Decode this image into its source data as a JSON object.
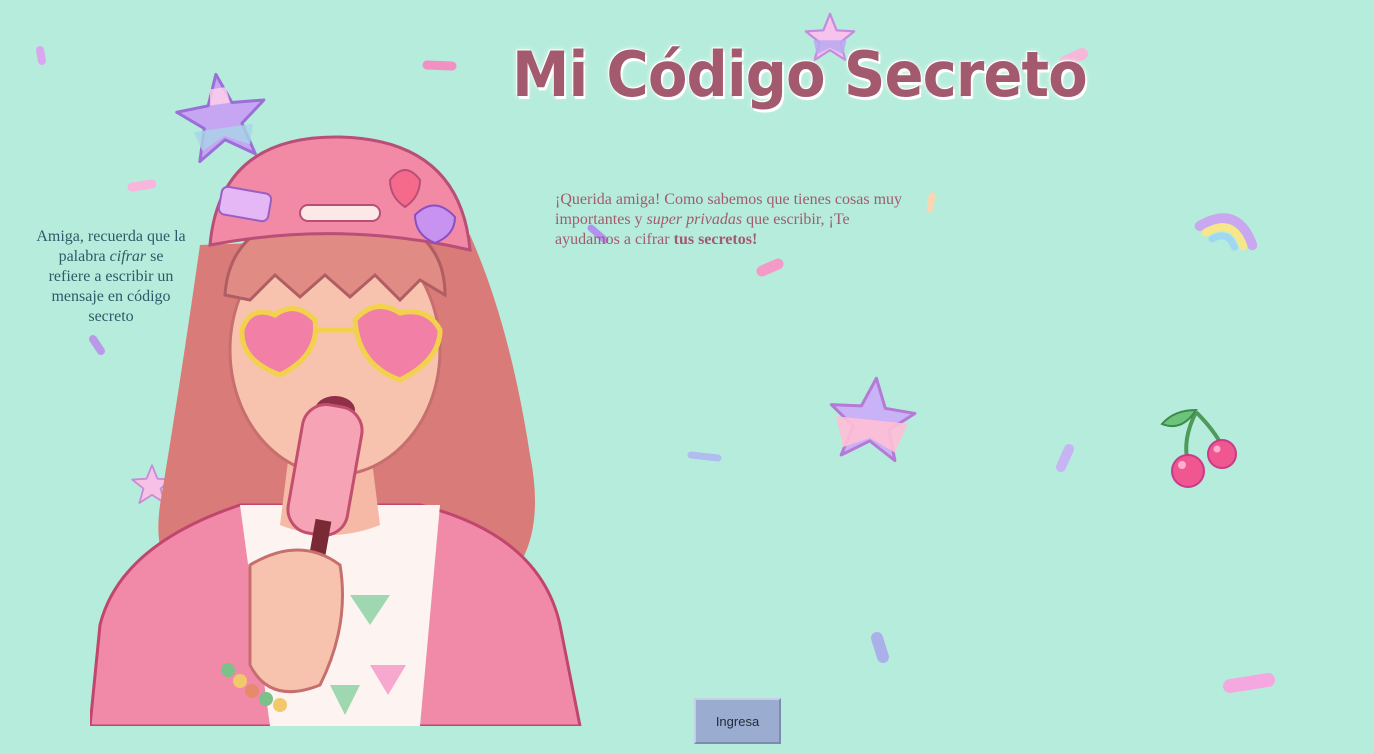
{
  "page": {
    "title": "Mi Código Secreto",
    "intro": {
      "part1": "¡Querida amiga! Como sabemos que tienes cosas muy importantes y ",
      "emphasis": "super privadas",
      "part2": " que escribir, ¡Te ayudamos a cifrar ",
      "strong": "tus secretos!"
    },
    "reminder": {
      "part1": "Amiga, recuerda que la palabra ",
      "emphasis": "cifrar",
      "part2": " se refiere a escribir un mensaje en código secreto"
    },
    "enter_button": "Ingresa"
  },
  "colors": {
    "background": "#b6ecdb",
    "title": "#a35a6e",
    "intro_text": "#a35a6e",
    "reminder_text": "#2e5a6a",
    "button": "#9aacd0"
  },
  "decorations": [
    "star-icon",
    "sprinkle-icon",
    "rainbow-icon",
    "cherry-icon"
  ],
  "illustration": "girl-with-popsicle-illustration"
}
